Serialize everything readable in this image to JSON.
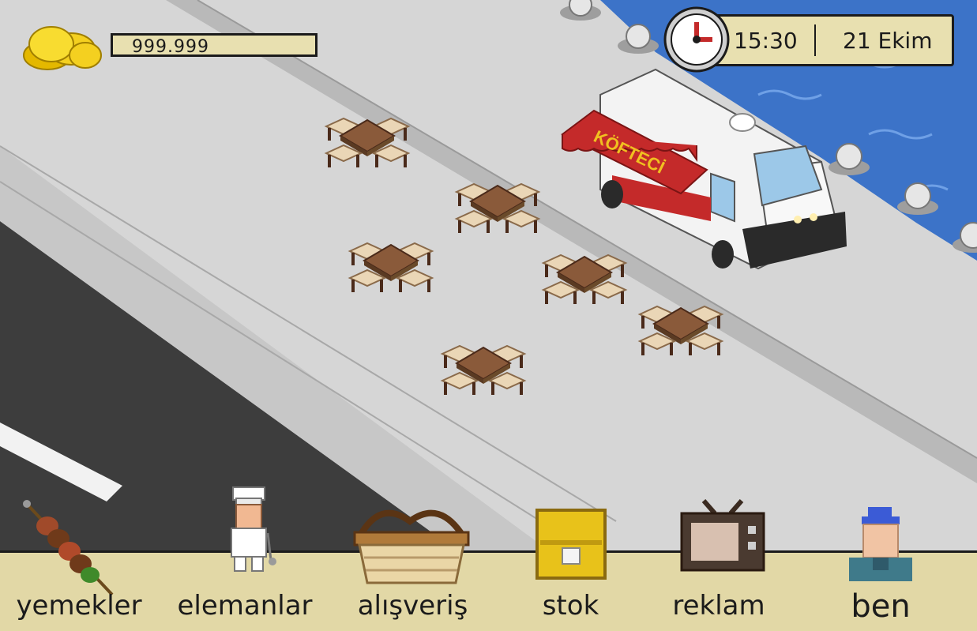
{
  "hud": {
    "coins": "999.999",
    "time": "15:30",
    "date": "21 Ekim"
  },
  "truck": {
    "sign": "KÖFTECİ"
  },
  "menu": {
    "items": [
      {
        "label": "yemekler",
        "icon": "kebab-skewer-icon"
      },
      {
        "label": "elemanlar",
        "icon": "chef-icon"
      },
      {
        "label": "alışveriş",
        "icon": "basket-icon"
      },
      {
        "label": "stok",
        "icon": "chest-icon"
      },
      {
        "label": "reklam",
        "icon": "tv-icon"
      },
      {
        "label": "ben",
        "icon": "avatar-icon"
      }
    ]
  },
  "colors": {
    "road": "#3d3d3d",
    "sidewalk": "#d6d6d6",
    "water": "#3c73c8",
    "panel": "#e8e0b0",
    "truck_awning": "#c42a2a",
    "sign_text": "#f0c020"
  }
}
